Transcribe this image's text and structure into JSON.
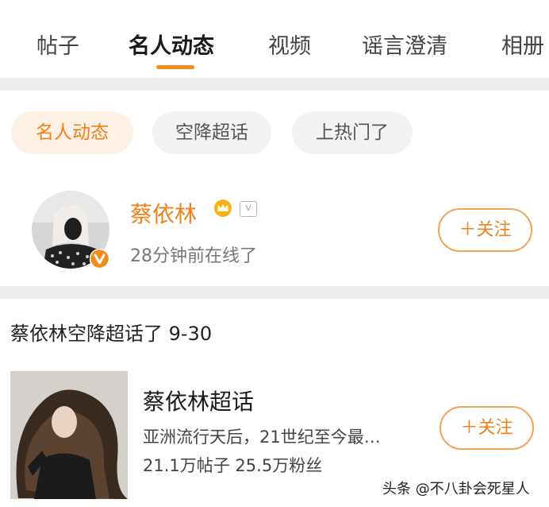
{
  "tabs": [
    {
      "label": "帖子",
      "active": false
    },
    {
      "label": "名人动态",
      "active": true
    },
    {
      "label": "视频",
      "active": false
    },
    {
      "label": "谣言澄清",
      "active": false
    },
    {
      "label": "相册",
      "active": false
    }
  ],
  "filter_chips": [
    {
      "label": "名人动态",
      "active": true
    },
    {
      "label": "空降超话",
      "active": false
    },
    {
      "label": "上热门了",
      "active": false
    }
  ],
  "celebrity": {
    "name": "蔡依林",
    "status": "28分钟前在线了",
    "follow_label": "关注",
    "follow_icon": "plus-icon",
    "badge_icons": [
      "crown-icon",
      "svip-badge-icon",
      "verified-v-icon"
    ]
  },
  "post": {
    "heading": "蔡依林空降超话了 9-30",
    "topic_name": "蔡依林超话",
    "description": "亚洲流行天后，21世纪至今最…",
    "stats": "21.1万帖子 25.5万粉丝",
    "follow_label": "关注",
    "follow_icon": "plus-icon"
  },
  "watermark": "头条 @不八卦会死星人",
  "colors": {
    "accent": "#f0811a",
    "follow_border": "#f2a35a",
    "active_chip_bg": "#fdf0e4",
    "chip_bg": "#f2f2f2",
    "separator": "#eeeeee",
    "verified_badge": "#f28a1c"
  }
}
